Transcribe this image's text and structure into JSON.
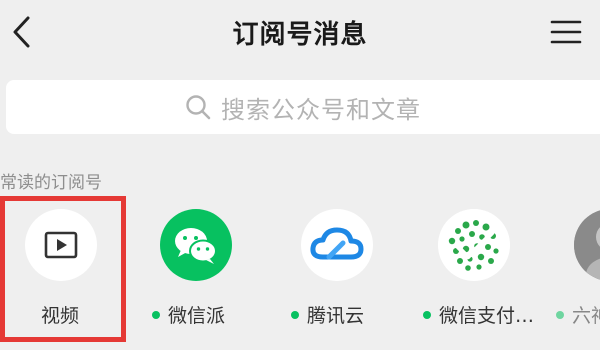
{
  "header": {
    "title": "订阅号消息"
  },
  "search": {
    "placeholder": "搜索公众号和文章"
  },
  "section": {
    "label": "常读的订阅号"
  },
  "accounts": [
    {
      "name": "视频",
      "unread_dot": false
    },
    {
      "name": "微信派",
      "unread_dot": true
    },
    {
      "name": "腾讯云",
      "unread_dot": true
    },
    {
      "name": "微信支付…",
      "unread_dot": true
    },
    {
      "name": "六神",
      "unread_dot": true
    }
  ],
  "colors": {
    "accent_green": "#07c160",
    "tencent_blue": "#1e88e5",
    "highlight_red": "#e53935"
  }
}
